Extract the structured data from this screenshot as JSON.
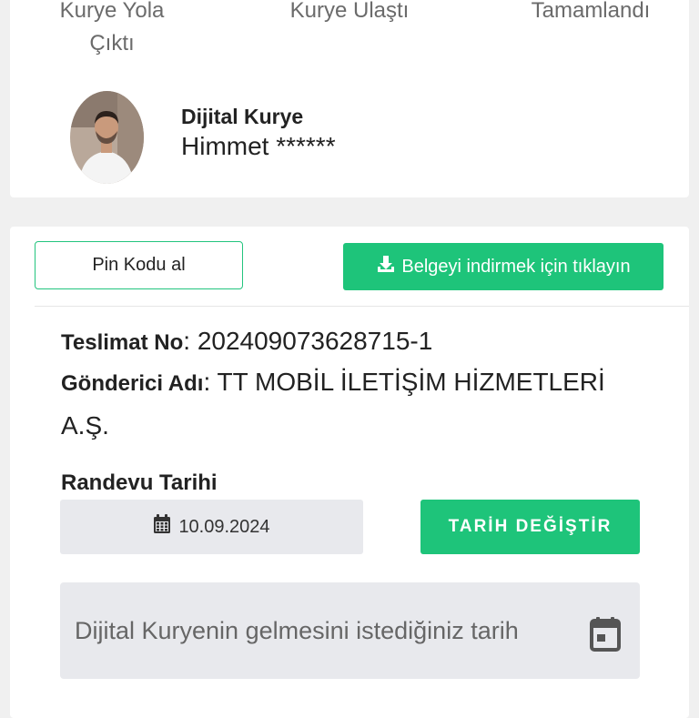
{
  "status_steps": {
    "step1": "Kurye Yola Çıktı",
    "step2": "Kurye Ulaştı",
    "step3": "Tamamlandı"
  },
  "courier": {
    "title": "Dijital Kurye",
    "name": "Himmet ******"
  },
  "actions": {
    "pin_label": "Pin Kodu al",
    "download_label": "Belgeyi indirmek için tıklayın"
  },
  "delivery": {
    "no_label": "Teslimat No",
    "no_value": "202409073628715-1",
    "sender_label": "Gönderici Adı",
    "sender_value": "TT MOBİL İLETİŞİM HİZMETLERİ A.Ş."
  },
  "appointment": {
    "title": "Randevu Tarihi",
    "date": "10.09.2024",
    "change_label": "TARİH DEĞİŞTİR",
    "request_placeholder": "Dijital Kuryenin gelmesini istediğiniz tarih"
  },
  "colors": {
    "accent": "#1ec47a",
    "field_bg": "#e8e9ed"
  },
  "icons": [
    "avatar",
    "download-icon",
    "calendar-icon",
    "calendar-outline-icon"
  ]
}
